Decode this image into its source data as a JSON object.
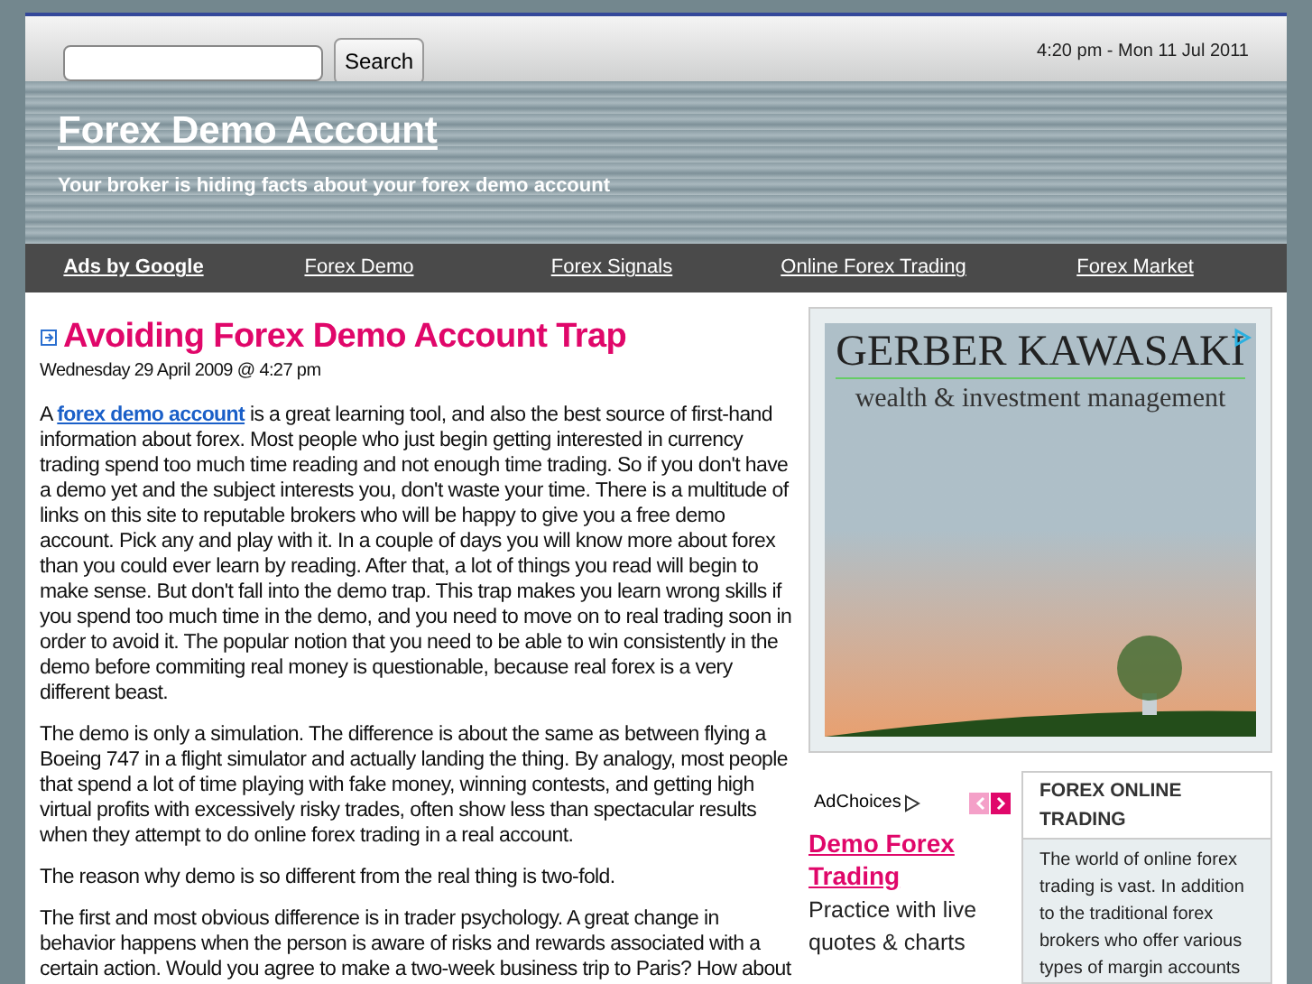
{
  "header": {
    "search_button": "Search",
    "datetime": "4:20 pm - Mon 11 Jul 2011"
  },
  "banner": {
    "title": "Forex Demo Account",
    "tagline": "Your broker is hiding facts about your forex demo account"
  },
  "nav": [
    {
      "label": "Ads by Google",
      "kind": "heading"
    },
    {
      "label": "Forex Demo",
      "kind": "link"
    },
    {
      "label": "Forex Signals",
      "kind": "link"
    },
    {
      "label": "Online Forex Trading",
      "kind": "link"
    },
    {
      "label": "Forex Market",
      "kind": "link"
    }
  ],
  "post": {
    "title": "Avoiding Forex Demo Account Trap",
    "date": "Wednesday 29 April 2009 @ 4:27 pm",
    "intro_before": "A",
    "intro_link": "forex demo account",
    "intro_after": "is a great learning tool, and also the best source of first-hand information about forex.  Most people who just begin getting interested in currency trading spend too much time reading and not enough time trading.  So if you don't have a demo yet and the subject interests you, don't waste your time.  There is a multitude of links on this site to reputable brokers who will be happy to give you a free demo account.  Pick any and play with it.  In a couple of days you will know more about forex than you could ever learn by reading.  After that, a lot of things you read will begin to make sense.  But don't fall into the demo trap.  This trap makes you learn wrong skills if you spend too much time in the demo, and you need to move on to real trading soon in order to avoid it.  The popular notion that you need to be able to win consistently in the demo before commiting real money is questionable, because real forex is a very different beast.",
    "paragraphs": [
      "The demo is only a simulation. The difference is about the same as between flying a Boeing 747 in a flight simulator and actually landing the thing. By analogy, most people that spend a lot of time playing with fake money, winning contests, and getting high virtual profits with excessively risky trades, often show less than spectacular results when they attempt to do online forex trading in a real account.",
      "The reason why demo is so different from the real thing is two-fold.",
      "The first and most obvious difference is in trader psychology. A great change in behavior happens when the person is aware of risks and rewards associated with a certain action. Would you agree to make a two-week business trip to Paris? How about"
    ]
  },
  "ad": {
    "brand": "GERBER KAWASAKI",
    "subtitle": "wealth & investment management",
    "adchoices": "AdChoices",
    "link_title": "Demo Forex Trading",
    "text": "Practice with live quotes & charts"
  },
  "widget": {
    "title": "FOREX ONLINE TRADING",
    "text": "The world of online forex trading is vast. In addition to the traditional forex brokers who offer various types of margin accounts"
  }
}
